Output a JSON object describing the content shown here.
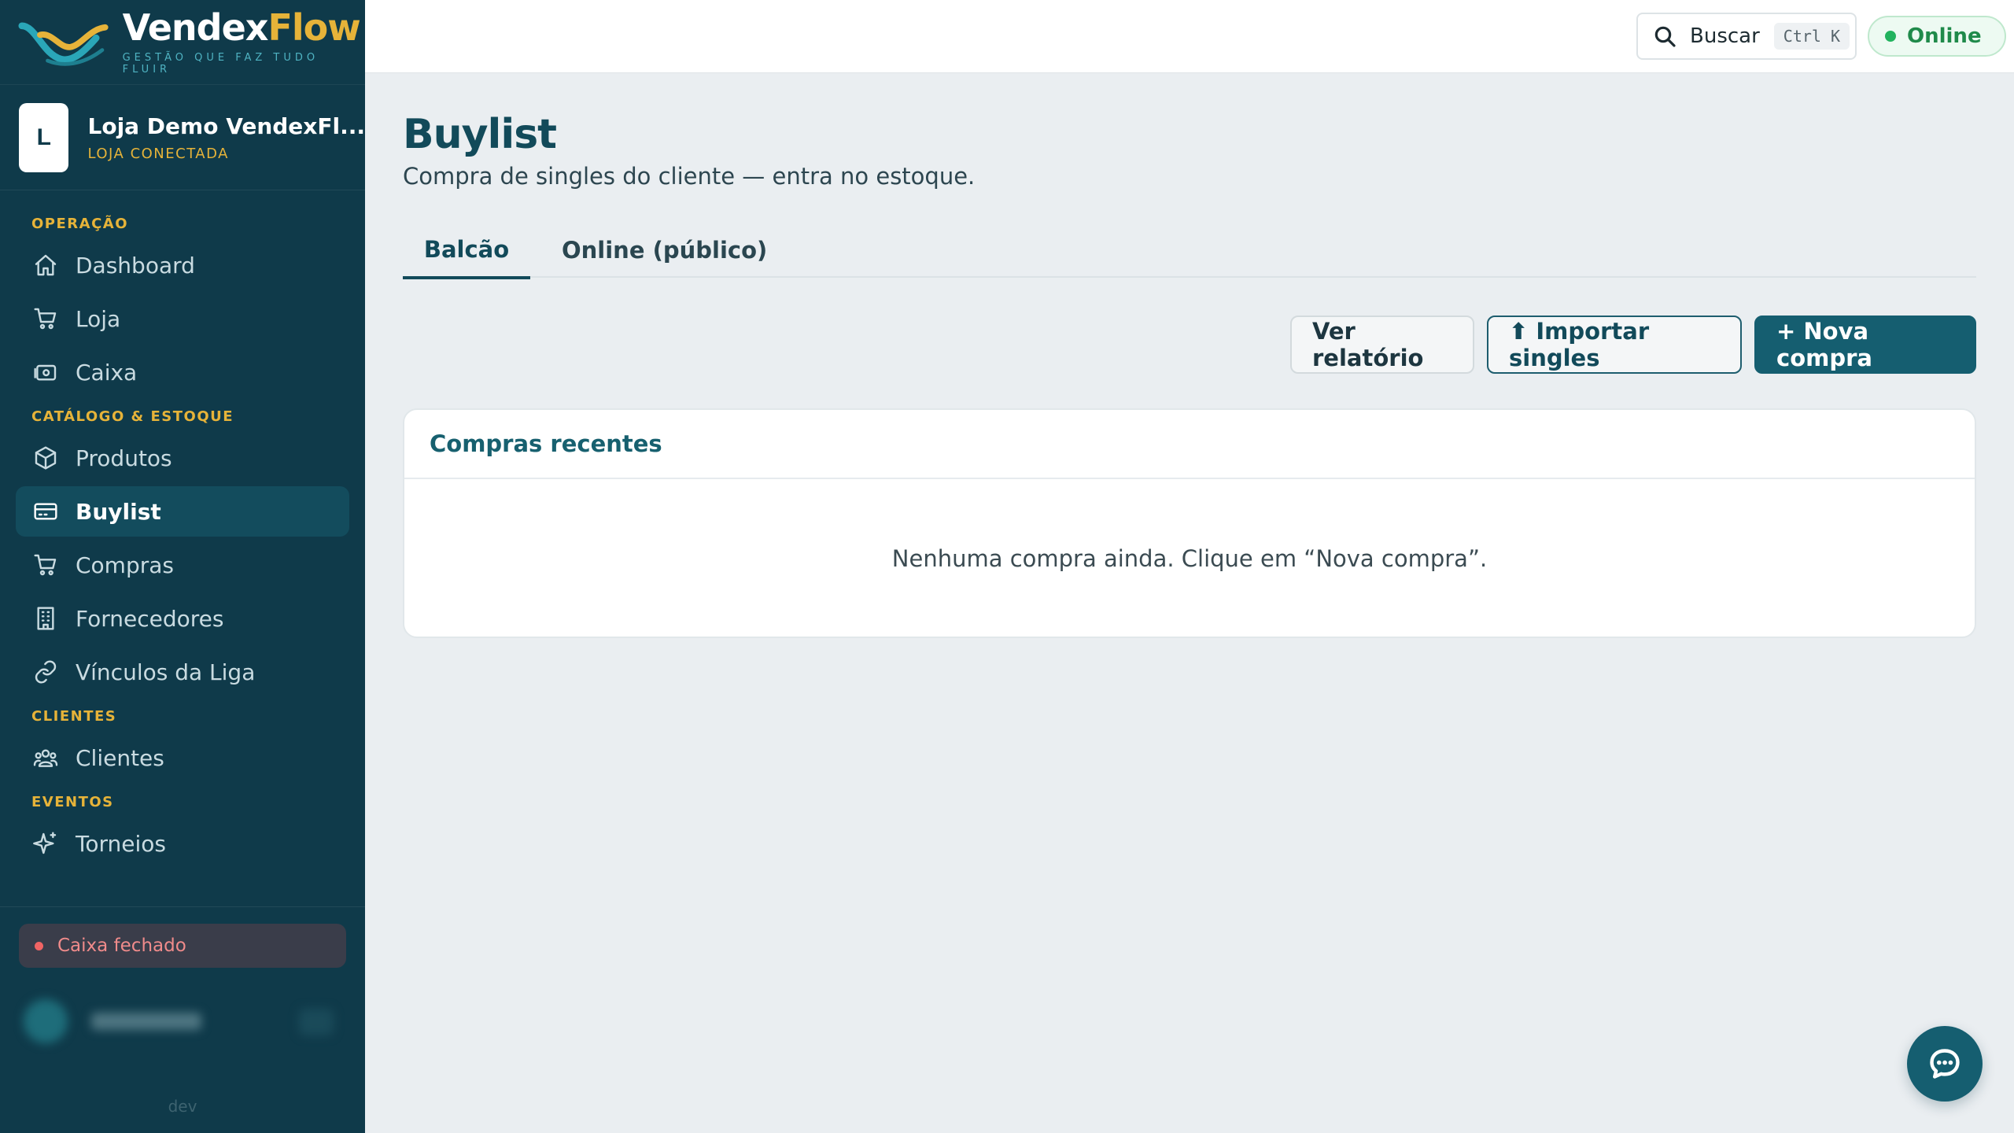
{
  "brand": {
    "name_part1": "Vendex",
    "name_part2": "Flow",
    "tagline": "GESTÃO QUE FAZ TUDO FLUIR"
  },
  "store": {
    "avatar_letter": "L",
    "name": "Loja Demo VendexFl...",
    "status": "LOJA CONECTADA"
  },
  "nav": {
    "sections": [
      {
        "title": "OPERAÇÃO",
        "items": [
          {
            "label": "Dashboard",
            "icon": "home-icon"
          },
          {
            "label": "Loja",
            "icon": "cart-icon"
          },
          {
            "label": "Caixa",
            "icon": "cash-register-icon"
          }
        ]
      },
      {
        "title": "CATÁLOGO & ESTOQUE",
        "items": [
          {
            "label": "Produtos",
            "icon": "box-icon"
          },
          {
            "label": "Buylist",
            "icon": "card-icon",
            "active": true
          },
          {
            "label": "Compras",
            "icon": "cart-icon"
          },
          {
            "label": "Fornecedores",
            "icon": "building-icon"
          },
          {
            "label": "Vínculos da Liga",
            "icon": "link-icon"
          }
        ]
      },
      {
        "title": "CLIENTES",
        "items": [
          {
            "label": "Clientes",
            "icon": "users-icon"
          }
        ]
      },
      {
        "title": "EVENTOS",
        "items": [
          {
            "label": "Torneios",
            "icon": "sparkle-icon"
          }
        ]
      }
    ]
  },
  "cash_status": "Caixa fechado",
  "env_label": "dev",
  "topbar": {
    "search_label": "Buscar",
    "search_shortcut": "Ctrl K",
    "connection_status": "Online"
  },
  "page": {
    "title": "Buylist",
    "subtitle": "Compra de singles do cliente — entra no estoque."
  },
  "tabs": {
    "balcao": "Balcão",
    "online": "Online (público)"
  },
  "actions": {
    "report": "Ver relatório",
    "import": "⬆ Importar singles",
    "new": "+ Nova compra"
  },
  "recent": {
    "title": "Compras recentes",
    "empty": "Nenhuma compra ainda. Clique em “Nova compra”."
  },
  "colors": {
    "sidebar_bg": "#0f3a4a",
    "accent": "#155e70",
    "brand_gold": "#e6b339",
    "online_green": "#22b35e",
    "cash_closed_red": "#f06464"
  }
}
